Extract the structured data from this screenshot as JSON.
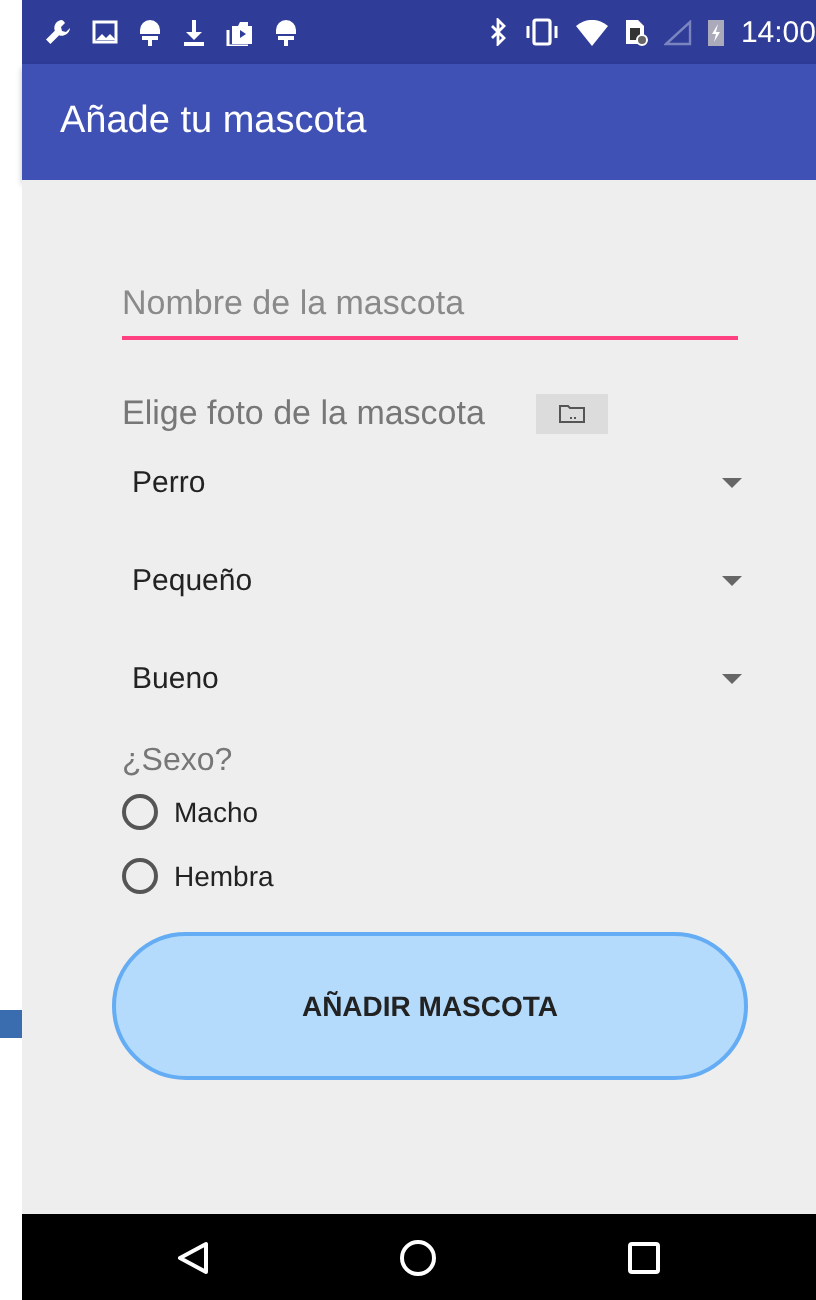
{
  "status_bar": {
    "time": "14:00"
  },
  "app_bar": {
    "title": "Añade tu mascota"
  },
  "name_field": {
    "placeholder": "Nombre de la mascota"
  },
  "photo_picker": {
    "label": "Elige foto de la mascota"
  },
  "spinners": [
    {
      "value": "Perro"
    },
    {
      "value": "Pequeño"
    },
    {
      "value": "Bueno"
    }
  ],
  "sex": {
    "label": "¿Sexo?",
    "options": [
      {
        "label": "Macho",
        "selected": false
      },
      {
        "label": "Hembra",
        "selected": false
      }
    ]
  },
  "submit_button": {
    "label": "AÑADIR MASCOTA"
  }
}
